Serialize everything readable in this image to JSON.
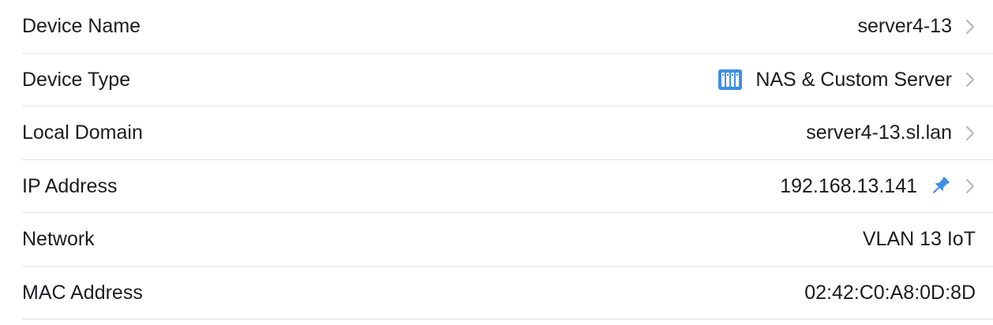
{
  "colors": {
    "accent": "#3b8ee6",
    "chevron": "#b8b8bd",
    "separator": "#e3e3e8",
    "text": "#1c1c1e"
  },
  "rows": [
    {
      "label": "Device Name",
      "value": "server4-13"
    },
    {
      "label": "Device Type",
      "value": "NAS & Custom Server",
      "icon": "nas-server-icon"
    },
    {
      "label": "Local Domain",
      "value": "server4-13.sl.lan"
    },
    {
      "label": "IP Address",
      "value": "192.168.13.141",
      "icon": "pin-icon"
    },
    {
      "label": "Network",
      "value": "VLAN 13 IoT"
    },
    {
      "label": "MAC Address",
      "value": "02:42:C0:A8:0D:8D"
    }
  ]
}
